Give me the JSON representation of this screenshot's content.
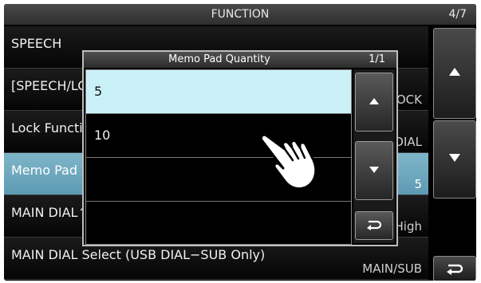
{
  "header": {
    "title": "FUNCTION",
    "page": "4/7"
  },
  "rows": [
    {
      "label": "SPEECH",
      "value": ""
    },
    {
      "label": "[SPEECH/LOCK] Switch",
      "value": "LOCK"
    },
    {
      "label": "Lock Function",
      "value": "DIAL"
    },
    {
      "label": "Memo Pad Quantity",
      "value": "5"
    },
    {
      "label": "MAIN DIAL↑/↓ Auto TS",
      "value": "High"
    },
    {
      "label": "MAIN DIAL Select (USB DIAL−SUB Only)",
      "value": "MAIN/SUB"
    }
  ],
  "dialog": {
    "title": "Memo Pad Quantity",
    "page": "1/1",
    "options": [
      "5",
      "10",
      "",
      ""
    ],
    "selected_index": 0
  },
  "icons": {
    "up": "up-arrow-icon",
    "down": "down-arrow-icon",
    "back": "return-icon",
    "pointer": "pointing-hand-icon"
  },
  "colors": {
    "selected_row": "#6aa8be",
    "selected_option": "#cbf1f8",
    "background": "#000000"
  }
}
